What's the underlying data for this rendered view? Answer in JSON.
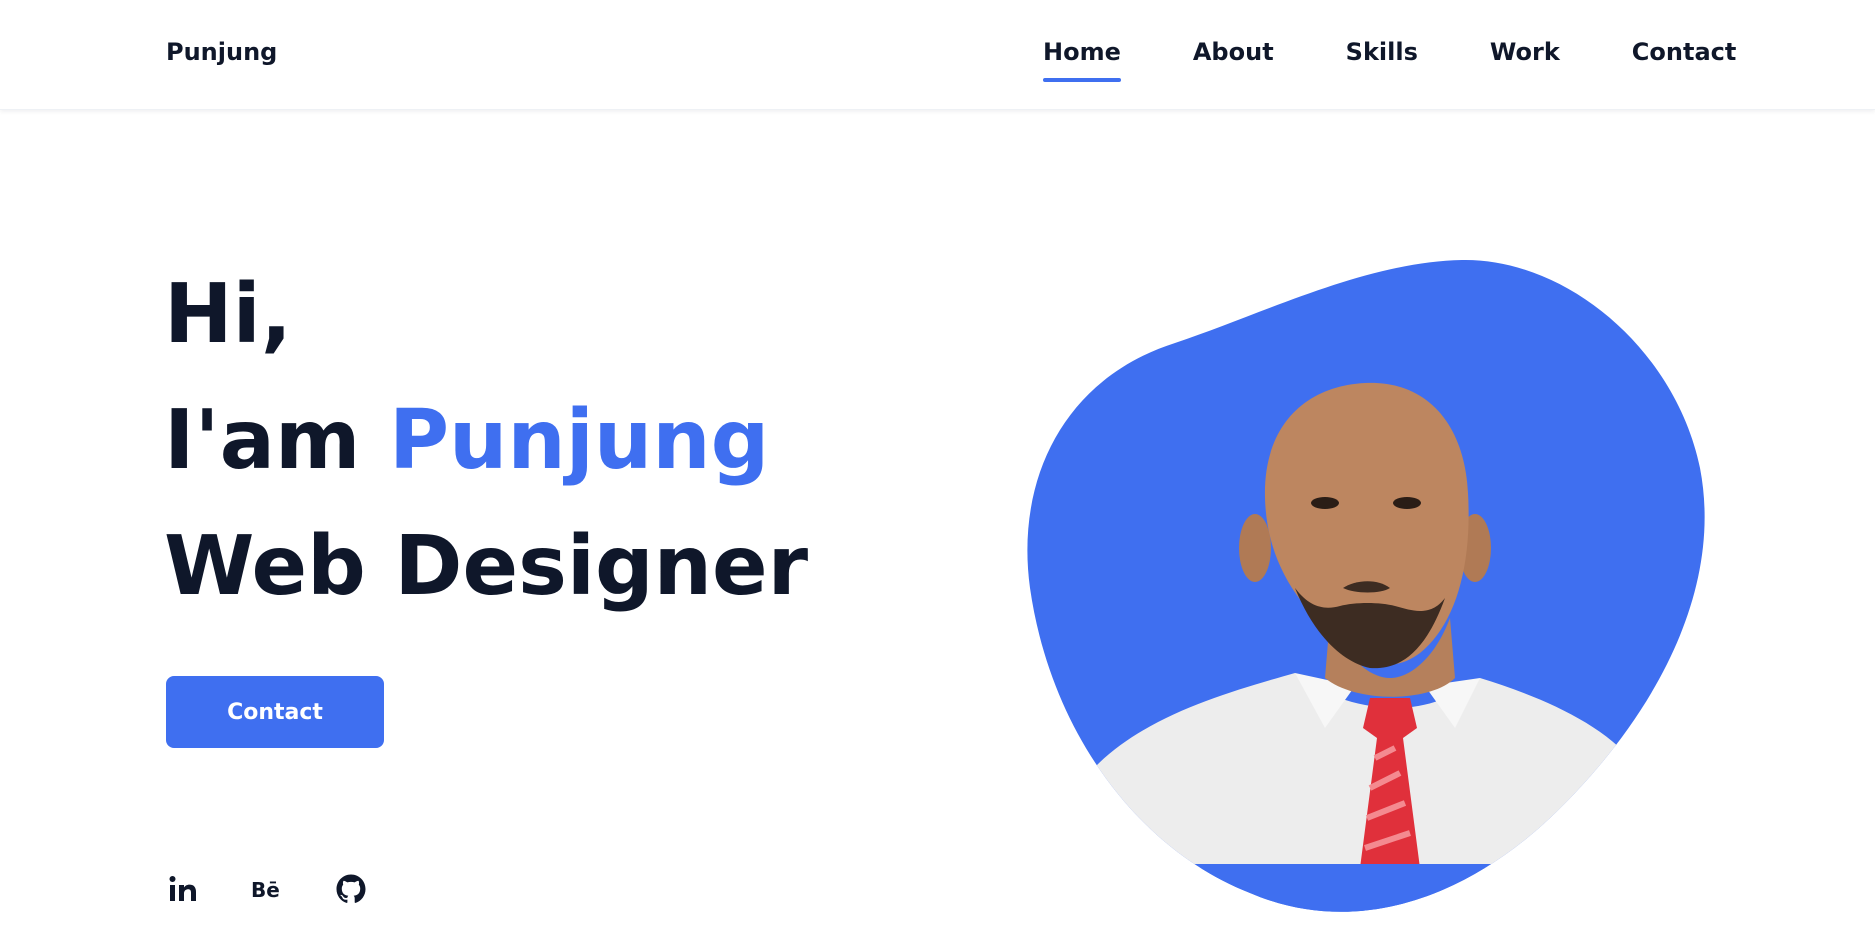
{
  "header": {
    "logo": "Punjung",
    "nav": [
      {
        "label": "Home",
        "active": true
      },
      {
        "label": "About",
        "active": false
      },
      {
        "label": "Skills",
        "active": false
      },
      {
        "label": "Work",
        "active": false
      },
      {
        "label": "Contact",
        "active": false
      }
    ]
  },
  "hero": {
    "line1": "Hi,",
    "line2_prefix": "I'am ",
    "line2_name": "Punjung",
    "line3": "Web Designer",
    "button_label": "Contact"
  },
  "social": {
    "behance_label": "Bē",
    "icons": [
      "linkedin-icon",
      "behance-icon",
      "github-icon"
    ]
  },
  "colors": {
    "accent": "#3f6ff0",
    "text": "#0f172a",
    "background": "#ffffff"
  }
}
